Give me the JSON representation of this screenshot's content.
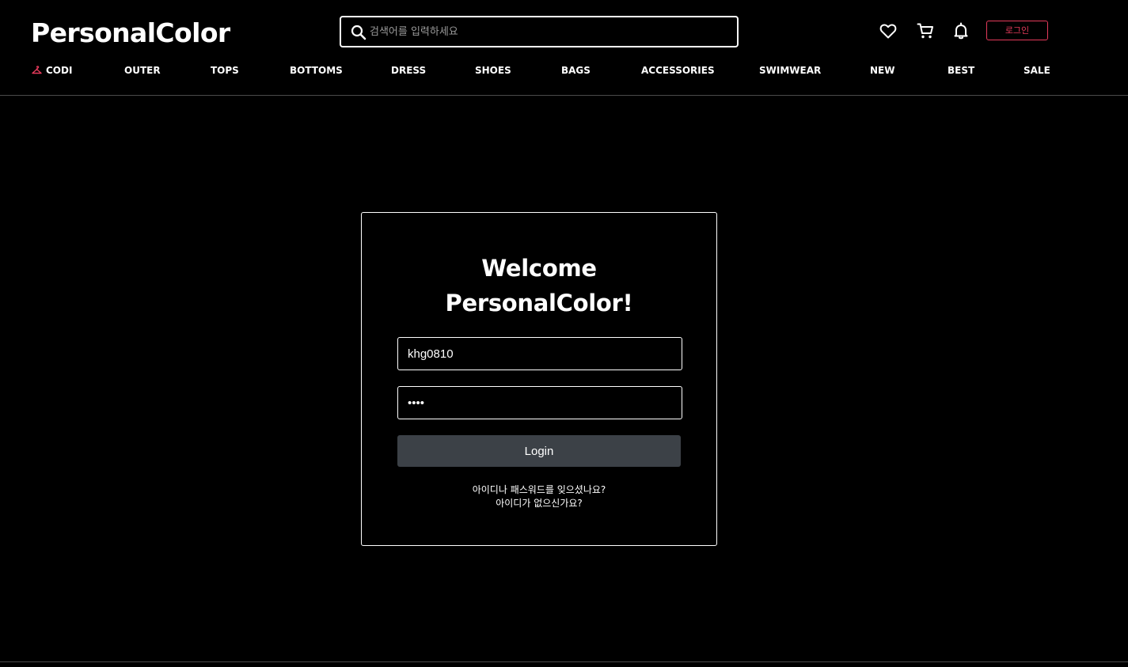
{
  "header": {
    "logo": "PersonalColor",
    "search_placeholder": "검색어를 입력하세요",
    "icons": [
      "search-icon",
      "heart-icon",
      "cart-icon",
      "bell-icon"
    ],
    "login_label": "로그인"
  },
  "nav": {
    "items": [
      {
        "label": "CODI",
        "icon": "hanger-icon"
      },
      {
        "label": "OUTER"
      },
      {
        "label": "TOPS"
      },
      {
        "label": "BOTTOMS"
      },
      {
        "label": "DRESS"
      },
      {
        "label": "SHOES"
      },
      {
        "label": "BAGS"
      },
      {
        "label": "ACCESSORIES"
      },
      {
        "label": "SWIMWEAR"
      },
      {
        "label": "NEW"
      },
      {
        "label": "BEST"
      },
      {
        "label": "SALE"
      }
    ]
  },
  "login": {
    "title_line1": "Welcome",
    "title_line2": "PersonalColor!",
    "username_value": "khg0810",
    "password_value": "1234",
    "button_label": "Login",
    "forgot_link": "아이디나 패스워드를 잊으셨나요?",
    "signup_link": "아이디가 없으신가요?"
  },
  "colors": {
    "background": "#000000",
    "accent": "#e53a5b",
    "button": "#3c4147",
    "text": "#ffffff"
  }
}
